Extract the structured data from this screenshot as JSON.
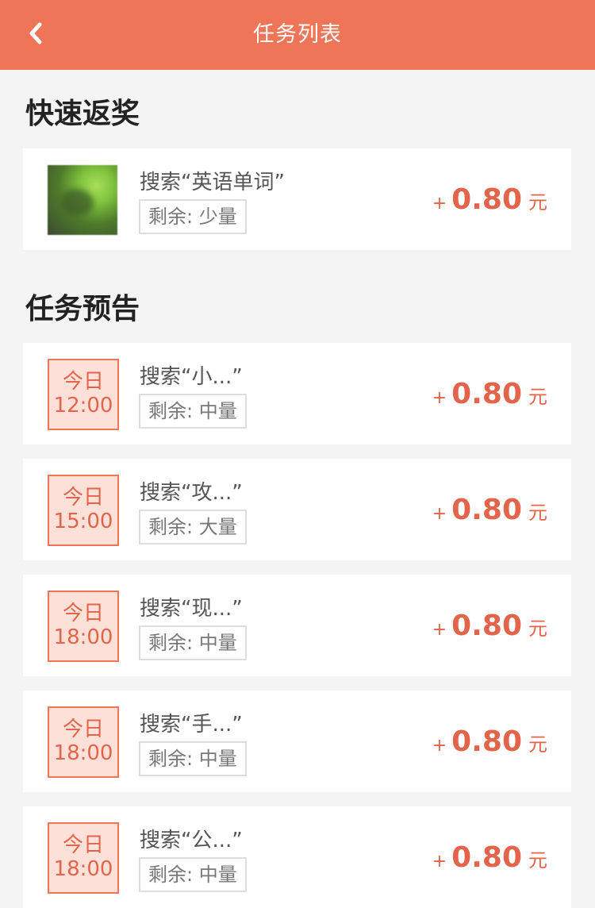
{
  "header": {
    "title": "任务列表",
    "back_icon": "chevron-left-icon",
    "background_color": "#ee7557"
  },
  "sections": [
    {
      "title": "快速返奖"
    },
    {
      "title": "任务预告"
    }
  ],
  "quick_tasks": [
    {
      "title": "搜索“英语单词”",
      "remain": "剩余: 少量",
      "plus": "+",
      "amount": "0.80",
      "unit": "元"
    }
  ],
  "preview_tasks": [
    {
      "day": "今日",
      "time": "12:00",
      "title": "搜索“小...”",
      "remain": "剩余: 中量",
      "plus": "+",
      "amount": "0.80",
      "unit": "元"
    },
    {
      "day": "今日",
      "time": "15:00",
      "title": "搜索“攻...”",
      "remain": "剩余: 大量",
      "plus": "+",
      "amount": "0.80",
      "unit": "元"
    },
    {
      "day": "今日",
      "time": "18:00",
      "title": "搜索“现...”",
      "remain": "剩余: 中量",
      "plus": "+",
      "amount": "0.80",
      "unit": "元"
    },
    {
      "day": "今日",
      "time": "18:00",
      "title": "搜索“手...”",
      "remain": "剩余: 中量",
      "plus": "+",
      "amount": "0.80",
      "unit": "元"
    },
    {
      "day": "今日",
      "time": "18:00",
      "title": "搜索“公...”",
      "remain": "剩余: 中量",
      "plus": "+",
      "amount": "0.80",
      "unit": "元"
    }
  ],
  "colors": {
    "accent": "#ee7557",
    "reward_text": "#e2644a",
    "time_box_fill": "#fde1d9"
  }
}
